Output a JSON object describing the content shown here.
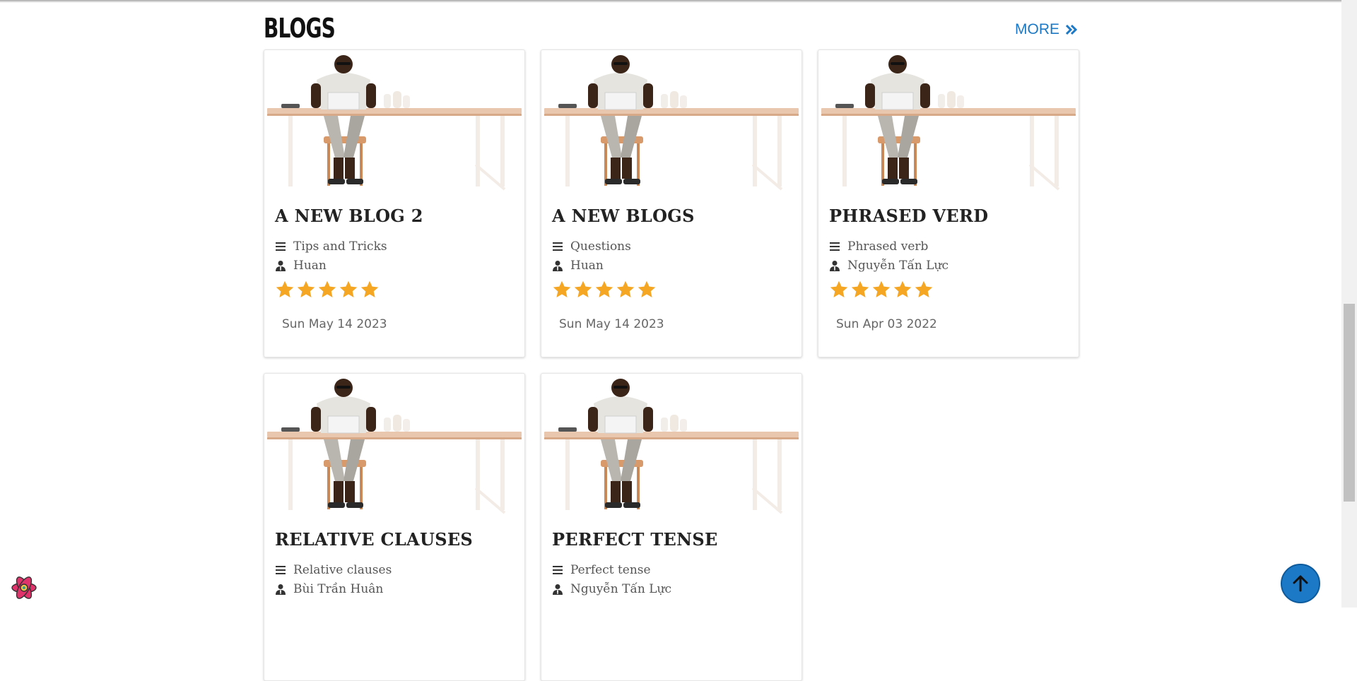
{
  "section": {
    "title": "BLOGS",
    "more_label": "MORE"
  },
  "colors": {
    "accent": "#1c79c6",
    "star": "#f5a623",
    "text": "#222222"
  },
  "blogs": [
    {
      "title": "A NEW BLOG 2",
      "category": "Tips and Tricks",
      "author": "Huan",
      "rating": 5,
      "date": "Sun May 14 2023"
    },
    {
      "title": "A NEW BLOGS",
      "category": "Questions",
      "author": "Huan",
      "rating": 5,
      "date": "Sun May 14 2023"
    },
    {
      "title": "PHRASED VERD",
      "category": "Phrased verb",
      "author": "Nguyễn Tấn Lực",
      "rating": 5,
      "date": "Sun Apr 03 2022"
    },
    {
      "title": "RELATIVE CLAUSES",
      "category": "Relative clauses",
      "author": "Bùi Trần Huân"
    },
    {
      "title": "PERFECT TENSE",
      "category": "Perfect tense",
      "author": "Nguyễn Tấn Lực"
    }
  ],
  "icons": {
    "more": "double-chevron-right-icon",
    "category": "list-icon",
    "author": "user-tie-icon",
    "date": "calendar-icon",
    "scroll_top": "arrow-up-icon",
    "floating_logo": "react-logo-icon"
  }
}
